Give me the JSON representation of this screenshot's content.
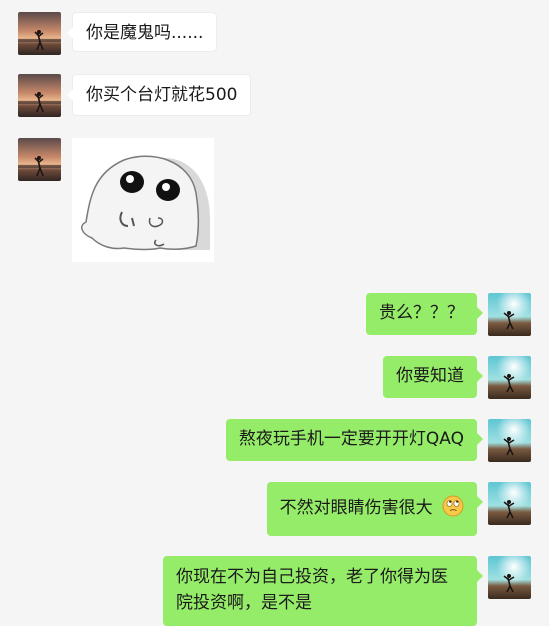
{
  "chat": {
    "messages": [
      {
        "side": "left",
        "text": "你是魔鬼吗......"
      },
      {
        "side": "left",
        "text": "你买个台灯就花500"
      },
      {
        "side": "left",
        "type": "sticker",
        "sticker_name": "crying-ghost-sticker"
      },
      {
        "side": "right",
        "text": "贵么？？？"
      },
      {
        "side": "right",
        "text": "你要知道"
      },
      {
        "side": "right",
        "text": "熬夜玩手机一定要开开灯QAQ"
      },
      {
        "side": "right",
        "text": "不然对眼睛伤害很大",
        "emoji": "eye-roll-emoji"
      },
      {
        "side": "right",
        "text": "你现在不为自己投资，老了你得为医院投资啊，是不是"
      }
    ]
  },
  "colors": {
    "background": "#f5f5f5",
    "self_bubble": "#95ec69",
    "other_bubble": "#ffffff"
  }
}
